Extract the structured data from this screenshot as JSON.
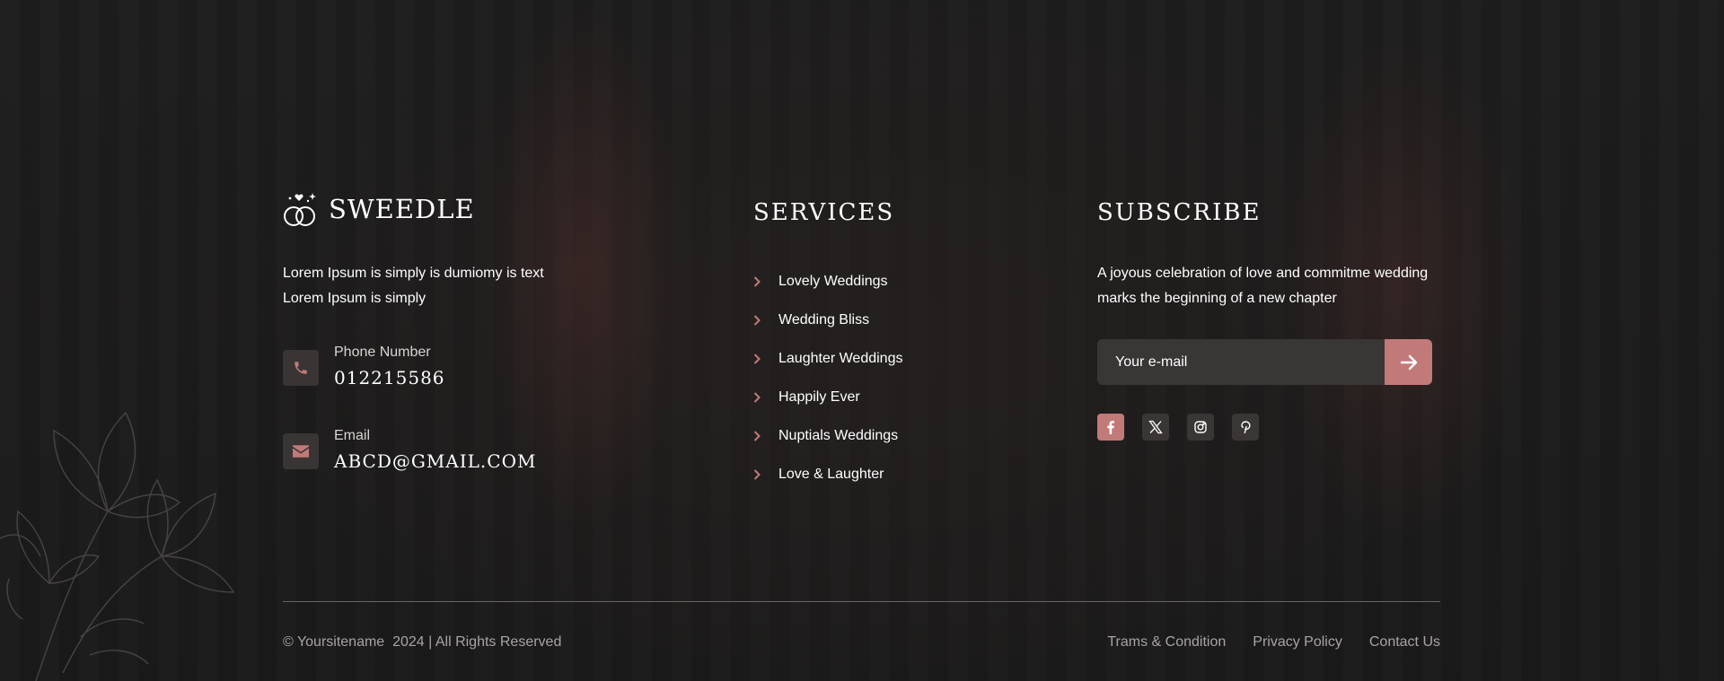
{
  "brand": {
    "name": "SWEEDLE",
    "about": "Lorem Ipsum is simply is dumiomy is text Lorem Ipsum is simply"
  },
  "contact": {
    "phone_label": "Phone Number",
    "phone_value": "012215586",
    "email_label": "Email",
    "email_value": "ABCD@GMAIL.COM"
  },
  "services": {
    "title": "SERVICES",
    "items": [
      {
        "label": "Lovely Weddings"
      },
      {
        "label": "Wedding Bliss"
      },
      {
        "label": "Laughter Weddings"
      },
      {
        "label": "Happily Ever"
      },
      {
        "label": "Nuptials Weddings"
      },
      {
        "label": "Love & Laughter"
      }
    ]
  },
  "subscribe": {
    "title": "SUBSCRIBE",
    "text": "A joyous celebration of love and commitme wedding marks the beginning of a new chapter",
    "input_placeholder": "Your e-mail",
    "input_value": "",
    "submit_icon": "arrow-right-icon",
    "socials": [
      {
        "icon": "facebook-icon",
        "active": true
      },
      {
        "icon": "x-twitter-icon",
        "active": false
      },
      {
        "icon": "instagram-icon",
        "active": false
      },
      {
        "icon": "pinterest-icon",
        "active": false
      }
    ]
  },
  "bottom": {
    "copyright": "© Yoursitename  2024 | All Rights Reserved",
    "links": [
      {
        "label": "Trams & Condition"
      },
      {
        "label": "Privacy Policy"
      },
      {
        "label": "Contact Us"
      }
    ]
  },
  "colors": {
    "accent": "#c27a78",
    "background": "#1c1b1b",
    "icon_box": "#3a3535",
    "muted_text": "#a9a4a3"
  }
}
